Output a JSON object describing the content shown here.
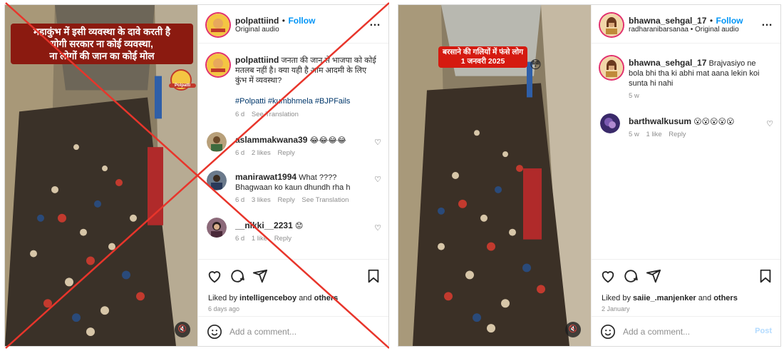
{
  "left_post": {
    "overlay_lines": [
      "महाकुंभ में इसी व्यवस्था के दावे करती है",
      "योगी सरकार ना कोई व्यवस्था,",
      "ना लोगों की जान का कोई मोल"
    ],
    "logo_text": "Polpatti",
    "header": {
      "username": "polpattiind",
      "dot": "•",
      "follow": "Follow",
      "subtitle": "Original audio",
      "more": "…"
    },
    "caption": {
      "username": "polpattiind",
      "text": "जनता की जान से भाजपा को कोई मतलब नहीं है। क्या यही है आम आदमी के लिए कुंभ में व्यवस्था?",
      "hashtags": "#Polpatti #kumbhmela #BJPFails",
      "time": "6 d",
      "translate": "See Translation"
    },
    "comments": [
      {
        "username": "aslammakwana39",
        "text": "😂😂😂😂",
        "text_line2": "",
        "time": "6 d",
        "likes": "2 likes",
        "reply": "Reply",
        "translate": ""
      },
      {
        "username": "manirawat1994",
        "text": "What ????",
        "text_line2": "Bhagwaan ko kaun dhundh rha h",
        "time": "6 d",
        "likes": "3 likes",
        "reply": "Reply",
        "translate": "See Translation"
      },
      {
        "username": "__nikki__2231",
        "text": "😟",
        "text_line2": "",
        "time": "6 d",
        "likes": "1 like",
        "reply": "Reply",
        "translate": ""
      }
    ],
    "liked_prefix": "Liked by",
    "liked_user": "intelligenceboy",
    "liked_and": "and",
    "liked_others": "others",
    "date": "6 days ago",
    "comment_placeholder": "Add a comment...",
    "mute_icon": "🔇"
  },
  "right_post": {
    "overlay_line1": "बरसाने की गलियों में फंसे लोग",
    "overlay_line2": "1 जनवरी 2025",
    "overlay_emoji": "😳",
    "header": {
      "username": "bhawna_sehgal_17",
      "dot": "•",
      "follow": "Follow",
      "subtitle": "radharanibarsanaa • Original audio",
      "more": "…"
    },
    "caption": {
      "username": "bhawna_sehgal_17",
      "text": "Brajvasiyo ne bola bhi tha ki abhi mat aana lekin koi sunta hi nahi",
      "time": "5 w"
    },
    "comments": [
      {
        "username": "barthwalkusum",
        "text": "😮😮😮😮😮",
        "time": "5 w",
        "likes": "1 like",
        "reply": "Reply"
      }
    ],
    "liked_prefix": "Liked by",
    "liked_user": "saiie_.manjenker",
    "liked_and": "and",
    "liked_others": "others",
    "date": "2 January",
    "comment_placeholder": "Add a comment...",
    "post_button": "Post",
    "mute_icon": "🔇"
  },
  "icons": {
    "heart": "heart-icon",
    "comment": "comment-icon",
    "share": "share-icon",
    "save": "bookmark-icon",
    "emoji": "emoji-icon"
  },
  "colors": {
    "cross": "#e8352b",
    "follow": "#0095f6",
    "banner_left": "#8b1a10",
    "banner_right": "#d51a10"
  }
}
